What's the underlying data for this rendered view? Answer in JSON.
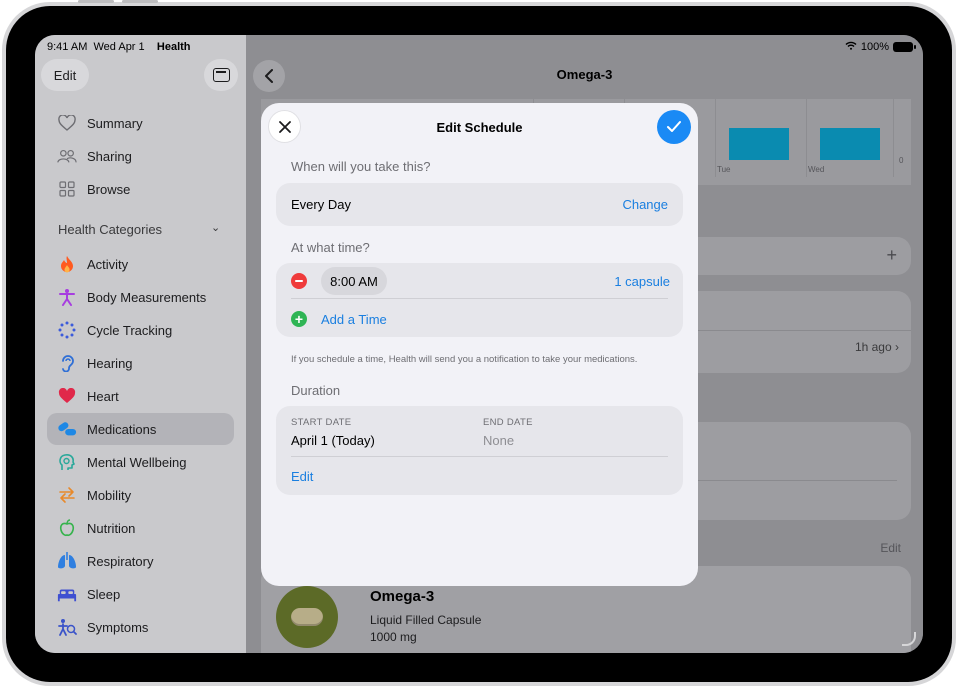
{
  "status_bar": {
    "time": "9:41 AM",
    "date": "Wed Apr 1",
    "app": "Health",
    "battery": "100%"
  },
  "sidebar": {
    "edit_label": "Edit",
    "top_items": [
      {
        "label": "Summary",
        "icon": "heart-outline-icon"
      },
      {
        "label": "Sharing",
        "icon": "people-icon"
      },
      {
        "label": "Browse",
        "icon": "grid-icon"
      }
    ],
    "categories_title": "Health Categories",
    "categories": [
      {
        "label": "Activity",
        "icon": "flame-icon",
        "color": "#ff5a1f"
      },
      {
        "label": "Body Measurements",
        "icon": "figure-icon",
        "color": "#a73de0"
      },
      {
        "label": "Cycle Tracking",
        "icon": "cycle-dots-icon",
        "color": "#3b5bdb"
      },
      {
        "label": "Hearing",
        "icon": "ear-icon",
        "color": "#2f6fd6"
      },
      {
        "label": "Heart",
        "icon": "heart-icon",
        "color": "#e0284a"
      },
      {
        "label": "Medications",
        "icon": "pills-icon",
        "color": "#1e88e5",
        "selected": true
      },
      {
        "label": "Mental Wellbeing",
        "icon": "head-icon",
        "color": "#2aa89a"
      },
      {
        "label": "Mobility",
        "icon": "arrows-icon",
        "color": "#e8892a"
      },
      {
        "label": "Nutrition",
        "icon": "apple-icon",
        "color": "#36b34c"
      },
      {
        "label": "Respiratory",
        "icon": "lungs-icon",
        "color": "#2f7fe0"
      },
      {
        "label": "Sleep",
        "icon": "bed-icon",
        "color": "#3e4fd1"
      },
      {
        "label": "Symptoms",
        "icon": "symptoms-icon",
        "color": "#3a53c9"
      }
    ]
  },
  "main": {
    "title": "Omega-3",
    "chart_day_labels": [
      "Tue",
      "Wed"
    ],
    "chart_zero_label": "0",
    "add_symbol": "+",
    "log_time": "1h ago",
    "edit_label": "Edit",
    "medication": {
      "name": "Omega-3",
      "form": "Liquid Filled Capsule",
      "strength": "1000 mg"
    }
  },
  "modal": {
    "title": "Edit Schedule",
    "frequency_heading": "When will you take this?",
    "frequency_value": "Every Day",
    "change_label": "Change",
    "time_heading": "At what time?",
    "time_value": "8:00 AM",
    "dose_label": "1 capsule",
    "add_time_label": "Add a Time",
    "footnote": "If you schedule a time, Health will send you a notification to take your medications.",
    "duration_heading": "Duration",
    "start_date_label": "START DATE",
    "start_date_value": "April 1 (Today)",
    "end_date_label": "END DATE",
    "end_date_value": "None",
    "edit_label": "Edit"
  }
}
